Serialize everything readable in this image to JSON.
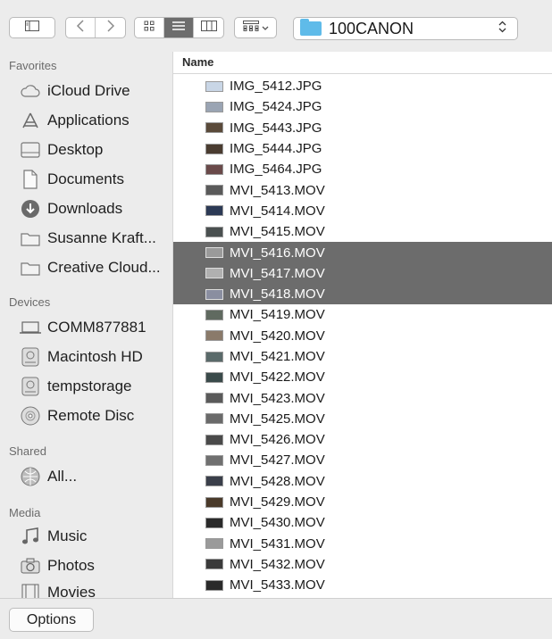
{
  "toolbar": {
    "location": "100CANON",
    "icons": [
      "sidebar-toggle-icon",
      "back-icon",
      "forward-icon",
      "icon-view-icon",
      "list-view-icon",
      "column-view-icon",
      "arrange-icon",
      "chevron-down-icon",
      "folder-icon",
      "up-down-arrows-icon"
    ],
    "active_view": "list"
  },
  "sidebar": {
    "favorites_label": "Favorites",
    "favorites": [
      {
        "label": "iCloud Drive",
        "icon": "cloud-icon"
      },
      {
        "label": "Applications",
        "icon": "applications-icon"
      },
      {
        "label": "Desktop",
        "icon": "desktop-icon"
      },
      {
        "label": "Documents",
        "icon": "document-icon"
      },
      {
        "label": "Downloads",
        "icon": "download-icon"
      },
      {
        "label": "Susanne Kraft...",
        "icon": "folder-icon"
      },
      {
        "label": "Creative Cloud...",
        "icon": "folder-icon"
      }
    ],
    "devices_label": "Devices",
    "devices": [
      {
        "label": "COMM877881",
        "icon": "laptop-icon"
      },
      {
        "label": "Macintosh HD",
        "icon": "harddisk-icon"
      },
      {
        "label": "tempstorage",
        "icon": "harddisk-icon"
      },
      {
        "label": "Remote Disc",
        "icon": "disc-icon"
      }
    ],
    "shared_label": "Shared",
    "shared": [
      {
        "label": "All...",
        "icon": "network-icon"
      }
    ],
    "media_label": "Media",
    "media": [
      {
        "label": "Music",
        "icon": "music-icon"
      },
      {
        "label": "Photos",
        "icon": "camera-icon"
      },
      {
        "label": "Movies",
        "icon": "film-icon"
      }
    ]
  },
  "list": {
    "column_header": "Name",
    "files": [
      {
        "name": "IMG_5412.JPG",
        "selected": false,
        "thumb": "#c9d6e6"
      },
      {
        "name": "IMG_5424.JPG",
        "selected": false,
        "thumb": "#9aa4b3"
      },
      {
        "name": "IMG_5443.JPG",
        "selected": false,
        "thumb": "#5a4a3a"
      },
      {
        "name": "IMG_5444.JPG",
        "selected": false,
        "thumb": "#4a3c30"
      },
      {
        "name": "IMG_5464.JPG",
        "selected": false,
        "thumb": "#6a4a4a"
      },
      {
        "name": "MVI_5413.MOV",
        "selected": false,
        "thumb": "#5a5a5a"
      },
      {
        "name": "MVI_5414.MOV",
        "selected": false,
        "thumb": "#2c3a55"
      },
      {
        "name": "MVI_5415.MOV",
        "selected": false,
        "thumb": "#4a5050"
      },
      {
        "name": "MVI_5416.MOV",
        "selected": true,
        "thumb": "#9a9a9a"
      },
      {
        "name": "MVI_5417.MOV",
        "selected": true,
        "thumb": "#b0b0b0"
      },
      {
        "name": "MVI_5418.MOV",
        "selected": true,
        "thumb": "#8a8ea0"
      },
      {
        "name": "MVI_5419.MOV",
        "selected": false,
        "thumb": "#606a60"
      },
      {
        "name": "MVI_5420.MOV",
        "selected": false,
        "thumb": "#8a7a6a"
      },
      {
        "name": "MVI_5421.MOV",
        "selected": false,
        "thumb": "#5a6a6a"
      },
      {
        "name": "MVI_5422.MOV",
        "selected": false,
        "thumb": "#3a4a4a"
      },
      {
        "name": "MVI_5423.MOV",
        "selected": false,
        "thumb": "#5a5a5a"
      },
      {
        "name": "MVI_5425.MOV",
        "selected": false,
        "thumb": "#6a6a6a"
      },
      {
        "name": "MVI_5426.MOV",
        "selected": false,
        "thumb": "#4a4a4a"
      },
      {
        "name": "MVI_5427.MOV",
        "selected": false,
        "thumb": "#707070"
      },
      {
        "name": "MVI_5428.MOV",
        "selected": false,
        "thumb": "#3a3f4a"
      },
      {
        "name": "MVI_5429.MOV",
        "selected": false,
        "thumb": "#4a3a2a"
      },
      {
        "name": "MVI_5430.MOV",
        "selected": false,
        "thumb": "#2a2a2a"
      },
      {
        "name": "MVI_5431.MOV",
        "selected": false,
        "thumb": "#9a9a9a"
      },
      {
        "name": "MVI_5432.MOV",
        "selected": false,
        "thumb": "#3a3a3a"
      },
      {
        "name": "MVI_5433.MOV",
        "selected": false,
        "thumb": "#2a2a2a"
      }
    ]
  },
  "footer": {
    "options_label": "Options"
  },
  "colors": {
    "selection": "#6c6c6c",
    "folder": "#5fbbe9",
    "window_bg": "#ececec"
  }
}
